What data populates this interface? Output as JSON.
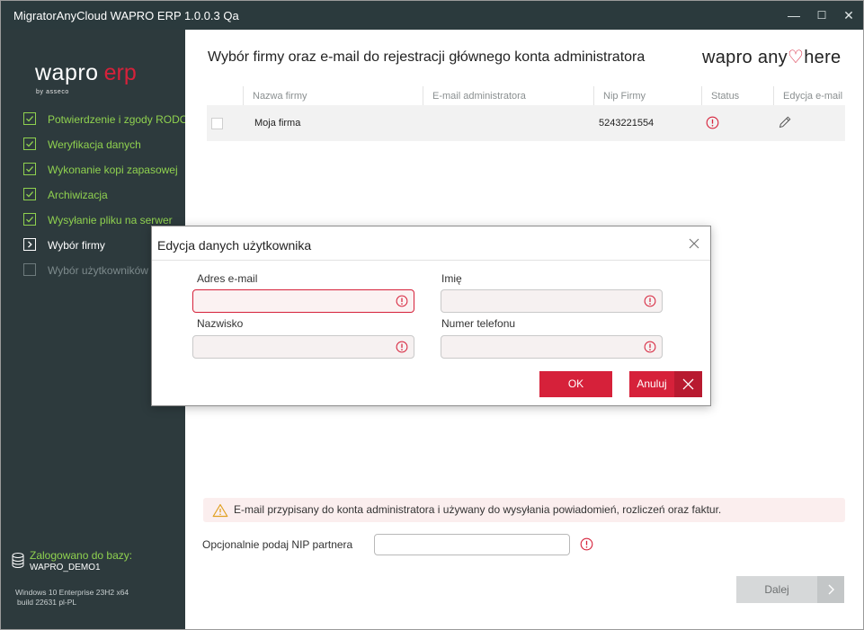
{
  "window": {
    "title": "MigratorAnyCloud WAPRO ERP 1.0.0.3 Qa",
    "minimize": "—",
    "maximize": "☐",
    "close": "✕"
  },
  "sidebar": {
    "logo_main": "wapro",
    "logo_accent": "erp",
    "logo_by": "by asseco",
    "steps": [
      {
        "label": "Potwierdzenie i zgody RODO",
        "state": "done"
      },
      {
        "label": "Weryfikacja danych",
        "state": "done"
      },
      {
        "label": "Wykonanie kopi zapasowej",
        "state": "done"
      },
      {
        "label": "Archiwizacja",
        "state": "done"
      },
      {
        "label": "Wysyłanie pliku na serwer",
        "state": "done"
      },
      {
        "label": "Wybór firmy",
        "state": "current"
      },
      {
        "label": "Wybór użytkowników",
        "state": "pending"
      }
    ],
    "db_label": "Zalogowano do bazy:",
    "db_name": "WAPRO_DEMO1",
    "system_line1": "Windows 10 Enterprise 23H2  x64",
    "system_line2": "build 22631 pl-PL"
  },
  "main": {
    "heading": "Wybór firmy oraz e-mail do rejestracji głównego konta administratora",
    "brand_a": "wapro any",
    "brand_b": "here",
    "columns": [
      "Nazwa firmy",
      "E-mail administratora",
      "Nip Firmy",
      "Status",
      "Edycja e-mail"
    ],
    "rows": [
      {
        "name": "Moja firma",
        "email": "",
        "nip": "5243221554"
      }
    ],
    "hint": "E-mail przypisany do konta administratora i używany do wysyłania powiadomień, rozliczeń oraz faktur.",
    "nip_label": "Opcjonalnie podaj NIP partnera",
    "nip_value": "",
    "next_label": "Dalej"
  },
  "dialog": {
    "title": "Edycja danych użytkownika",
    "fields": {
      "email": {
        "label": "Adres e-mail",
        "value": ""
      },
      "first_name": {
        "label": "Imię",
        "value": ""
      },
      "last_name": {
        "label": "Nazwisko",
        "value": ""
      },
      "phone": {
        "label": "Numer telefonu",
        "value": ""
      }
    },
    "ok_label": "OK",
    "cancel_label": "Anuluj"
  },
  "colors": {
    "accent_red": "#d6213a",
    "sidebar_bg": "#2d3a3d",
    "done_green": "#8fd14f"
  }
}
